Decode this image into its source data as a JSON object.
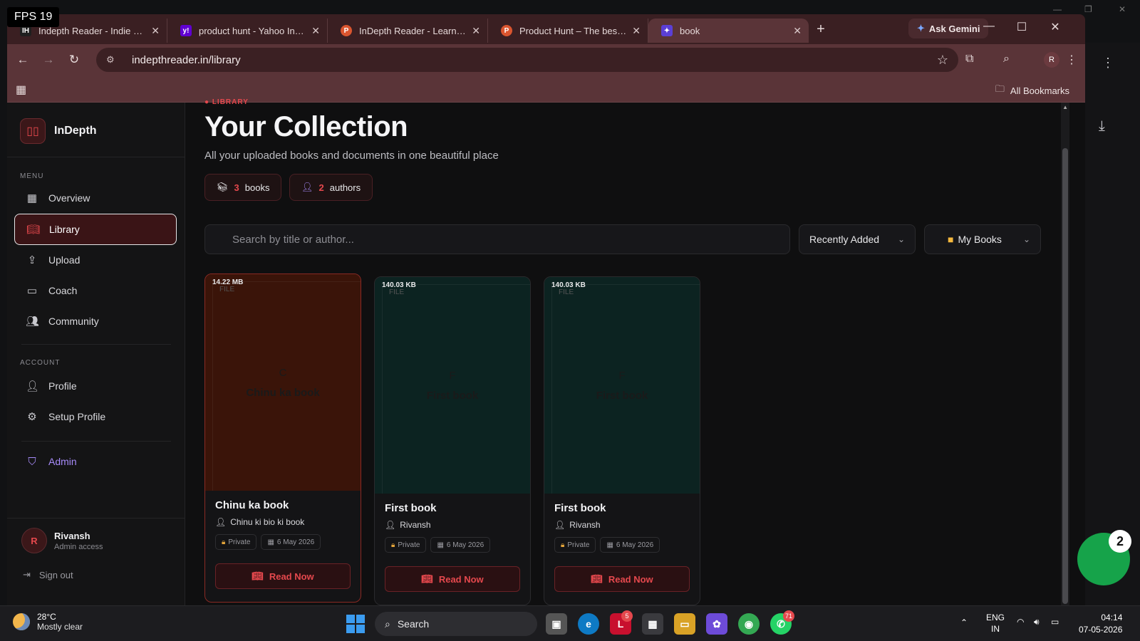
{
  "overlay": {
    "fps": "FPS 19"
  },
  "browser": {
    "tabs": [
      {
        "label": "Indepth Reader - Indie Hack",
        "favicon": "IH",
        "color": "#1f1f1f"
      },
      {
        "label": "product hunt - Yahoo India S",
        "favicon": "y!",
        "color": "#6001d2"
      },
      {
        "label": "InDepth Reader - Learning m",
        "favicon": "P",
        "color": "#da552f"
      },
      {
        "label": "Product Hunt – The best new",
        "favicon": "P",
        "color": "#da552f"
      },
      {
        "label": "book",
        "favicon": "✦",
        "color": "#5b3fd6"
      }
    ],
    "ask_gemini": "Ask Gemini",
    "url": "indepthreader.in/library",
    "profile_initial": "R",
    "all_bookmarks": "All Bookmarks"
  },
  "sidebar": {
    "brand": "InDepth",
    "menu_label": "MENU",
    "menu": [
      {
        "label": "Overview",
        "icon": "grid-icon"
      },
      {
        "label": "Library",
        "icon": "book-icon"
      },
      {
        "label": "Upload",
        "icon": "upload-icon"
      },
      {
        "label": "Coach",
        "icon": "chat-icon"
      },
      {
        "label": "Community",
        "icon": "users-icon"
      }
    ],
    "account_label": "ACCOUNT",
    "account": [
      {
        "label": "Profile",
        "icon": "user-icon"
      },
      {
        "label": "Setup Profile",
        "icon": "gear-icon"
      }
    ],
    "admin": "Admin",
    "user": {
      "initial": "R",
      "name": "Rivansh",
      "role": "Admin access"
    },
    "sign_out": "Sign out"
  },
  "main": {
    "crumb": "● LIBRARY",
    "title": "Your Collection",
    "subtitle": "All your uploaded books and documents in one beautiful place",
    "stats": [
      {
        "count": "3",
        "label": "books"
      },
      {
        "count": "2",
        "label": "authors"
      }
    ],
    "search_placeholder": "Search by title or author...",
    "sort": "Recently Added",
    "folder": "My Books",
    "books": [
      {
        "size": "14.22 MB",
        "tag": "FILE",
        "letter": "C",
        "cover_title": "Chinu ka book",
        "title": "Chinu ka book",
        "author": "Chinu ki bio ki book",
        "visibility": "Private",
        "date": "6 May 2026",
        "action": "Read Now"
      },
      {
        "size": "140.03 KB",
        "tag": "FILE",
        "letter": "F",
        "cover_title": "First book",
        "title": "First book",
        "author": "Rivansh",
        "visibility": "Private",
        "date": "6 May 2026",
        "action": "Read Now"
      },
      {
        "size": "140.03 KB",
        "tag": "FILE",
        "letter": "F",
        "cover_title": "First book",
        "title": "First book",
        "author": "Rivansh",
        "visibility": "Private",
        "date": "6 May 2026",
        "action": "Read Now"
      }
    ]
  },
  "desktop": {
    "notification_count": "2"
  },
  "taskbar": {
    "weather_temp": "28°C",
    "weather_cond": "Mostly clear",
    "search": "Search",
    "lang": "ENG",
    "region": "IN",
    "time": "04:14",
    "date": "07-05-2026",
    "badges": {
      "l_app": "5",
      "whatsapp": "71"
    }
  }
}
